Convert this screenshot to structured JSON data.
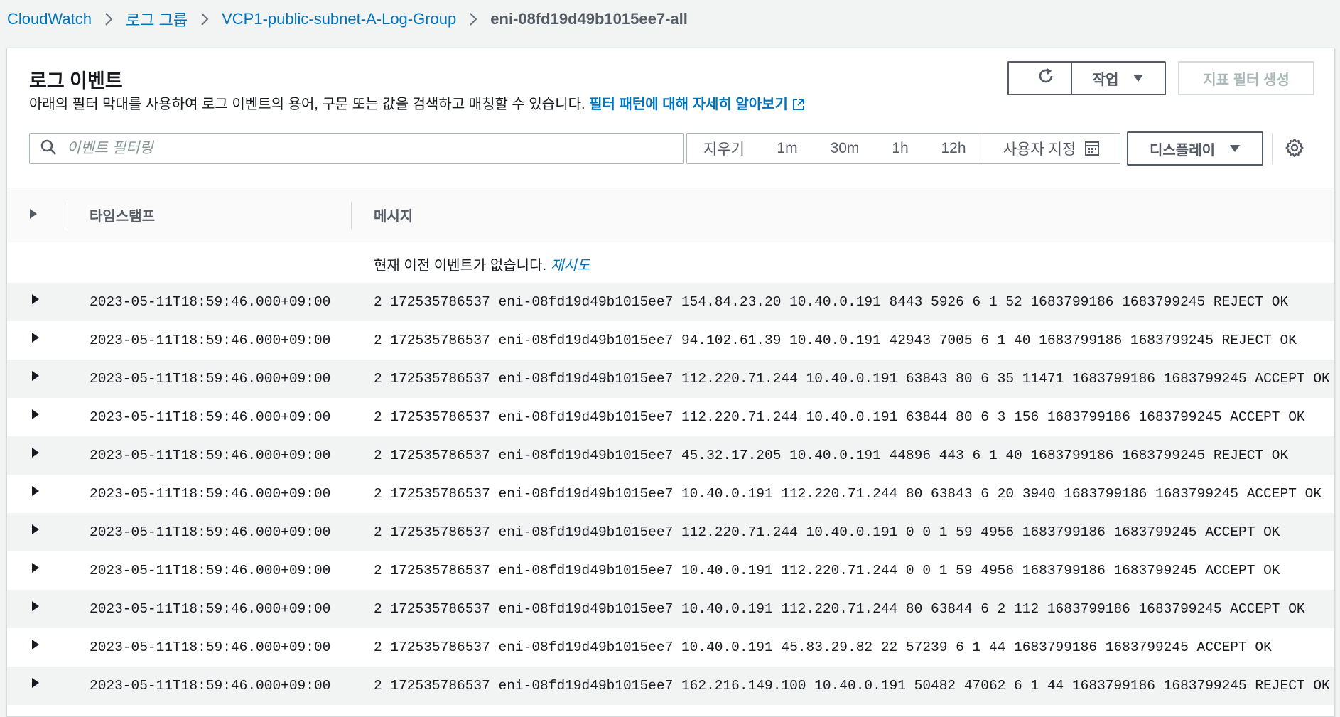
{
  "breadcrumb": {
    "items": [
      "CloudWatch",
      "로그 그룹",
      "VCP1-public-subnet-A-Log-Group"
    ],
    "current": "eni-08fd19d49b1015ee7-all"
  },
  "header": {
    "title": "로그 이벤트",
    "description": "아래의 필터 막대를 사용하여 로그 이벤트의 용어, 구문 또는 값을 검색하고 매칭할 수 있습니다.",
    "learn_more": "필터 패턴에 대해 자세히 알아보기"
  },
  "toolbar": {
    "refresh_icon": "refresh-icon",
    "actions_label": "작업",
    "create_metric_filter_label": "지표 필터 생성"
  },
  "filter": {
    "placeholder": "이벤트 필터링",
    "value": ""
  },
  "time_range": {
    "clear_label": "지우기",
    "options": [
      "1m",
      "30m",
      "1h",
      "12h"
    ],
    "custom_label": "사용자 지정"
  },
  "display_label": "디스플레이",
  "table": {
    "columns": {
      "timestamp": "타임스탬프",
      "message": "메시지"
    },
    "notice": "현재 이전 이벤트가 없습니다.",
    "retry_label": "재시도",
    "rows": [
      {
        "timestamp": "2023-05-11T18:59:46.000+09:00",
        "message": "2 172535786537 eni-08fd19d49b1015ee7 154.84.23.20 10.40.0.191 8443 5926 6 1 52 1683799186 1683799245 REJECT OK"
      },
      {
        "timestamp": "2023-05-11T18:59:46.000+09:00",
        "message": "2 172535786537 eni-08fd19d49b1015ee7 94.102.61.39 10.40.0.191 42943 7005 6 1 40 1683799186 1683799245 REJECT OK"
      },
      {
        "timestamp": "2023-05-11T18:59:46.000+09:00",
        "message": "2 172535786537 eni-08fd19d49b1015ee7 112.220.71.244 10.40.0.191 63843 80 6 35 11471 1683799186 1683799245 ACCEPT OK"
      },
      {
        "timestamp": "2023-05-11T18:59:46.000+09:00",
        "message": "2 172535786537 eni-08fd19d49b1015ee7 112.220.71.244 10.40.0.191 63844 80 6 3 156 1683799186 1683799245 ACCEPT OK"
      },
      {
        "timestamp": "2023-05-11T18:59:46.000+09:00",
        "message": "2 172535786537 eni-08fd19d49b1015ee7 45.32.17.205 10.40.0.191 44896 443 6 1 40 1683799186 1683799245 REJECT OK"
      },
      {
        "timestamp": "2023-05-11T18:59:46.000+09:00",
        "message": "2 172535786537 eni-08fd19d49b1015ee7 10.40.0.191 112.220.71.244 80 63843 6 20 3940 1683799186 1683799245 ACCEPT OK"
      },
      {
        "timestamp": "2023-05-11T18:59:46.000+09:00",
        "message": "2 172535786537 eni-08fd19d49b1015ee7 112.220.71.244 10.40.0.191 0 0 1 59 4956 1683799186 1683799245 ACCEPT OK"
      },
      {
        "timestamp": "2023-05-11T18:59:46.000+09:00",
        "message": "2 172535786537 eni-08fd19d49b1015ee7 10.40.0.191 112.220.71.244 0 0 1 59 4956 1683799186 1683799245 ACCEPT OK"
      },
      {
        "timestamp": "2023-05-11T18:59:46.000+09:00",
        "message": "2 172535786537 eni-08fd19d49b1015ee7 10.40.0.191 112.220.71.244 80 63844 6 2 112 1683799186 1683799245 ACCEPT OK"
      },
      {
        "timestamp": "2023-05-11T18:59:46.000+09:00",
        "message": "2 172535786537 eni-08fd19d49b1015ee7 10.40.0.191 45.83.29.82 22 57239 6 1 44 1683799186 1683799245 ACCEPT OK"
      },
      {
        "timestamp": "2023-05-11T18:59:46.000+09:00",
        "message": "2 172535786537 eni-08fd19d49b1015ee7 162.216.149.100 10.40.0.191 50482 47062 6 1 44 1683799186 1683799245 REJECT OK"
      }
    ]
  },
  "colors": {
    "link": "#0073bb",
    "border": "#545b64",
    "row_alt": "#f2f3f3",
    "background": "#f2f3f3"
  }
}
